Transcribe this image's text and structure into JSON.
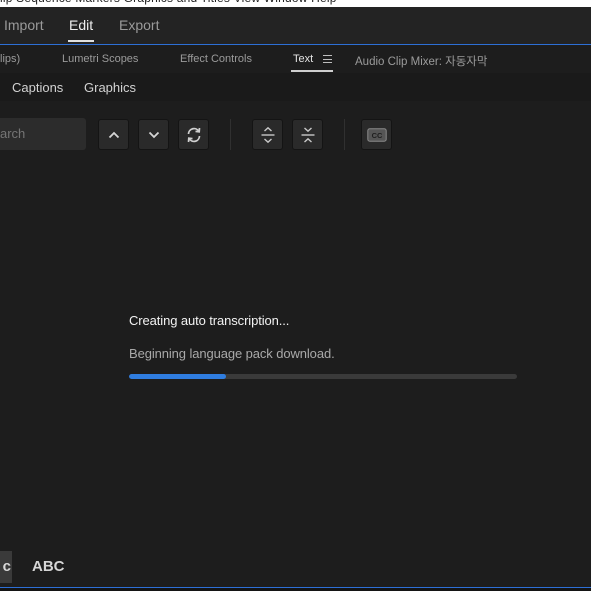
{
  "menubar": {
    "items": [
      "lip",
      "Sequence",
      "Markers",
      "Graphics and Titles",
      "View",
      "Window",
      "Help"
    ]
  },
  "workspace": {
    "tabs": [
      {
        "label": "Import"
      },
      {
        "label": "Edit"
      },
      {
        "label": "Export"
      }
    ],
    "active": "Edit"
  },
  "panel_tabs": {
    "items": [
      {
        "label": "lips)"
      },
      {
        "label": "Lumetri Scopes"
      },
      {
        "label": "Effect Controls"
      },
      {
        "label": "Text"
      },
      {
        "label": "Audio Clip Mixer: 자동자막"
      }
    ],
    "active": "Text"
  },
  "subtabs": {
    "captions": "Captions",
    "graphics": "Graphics"
  },
  "toolbar": {
    "search_placeholder": "arch",
    "icons": [
      "chevron-up-icon",
      "chevron-down-icon",
      "refresh-icon",
      "expand-icon",
      "collapse-icon",
      "closed-captions-icon"
    ],
    "cc_label": "CC"
  },
  "status": {
    "title": "Creating auto transcription...",
    "message": "Beginning language pack download.",
    "progress": 0.25,
    "progress_color": "#2f7de0"
  },
  "bottom": {
    "case_lower": "c",
    "case_upper": "ABC"
  }
}
